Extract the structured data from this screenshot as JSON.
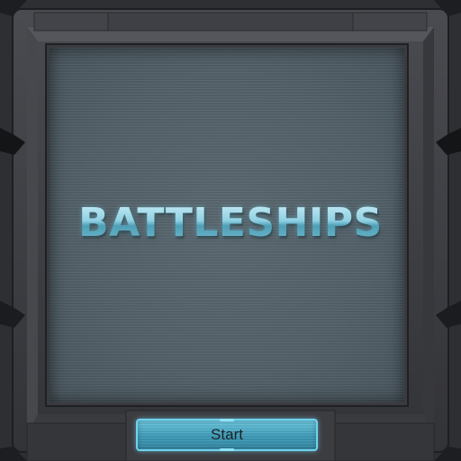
{
  "game": {
    "title": "BATTLESHIPS",
    "start_label": "Start"
  },
  "colors": {
    "title_glow": "#a7dbe8",
    "button_fill": "#4fb0cc",
    "button_border": "#6fd3ef",
    "frame_metal": "#3b3c40",
    "panel_screen": "#57656d"
  }
}
